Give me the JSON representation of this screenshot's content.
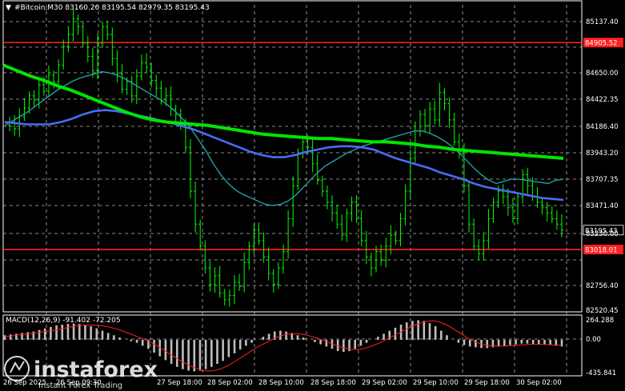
{
  "header": {
    "symbol_line": "#Bitcoin,M30  83160.26 83195.54 82979.35 83195.43",
    "macd_line": "MACD(12,26,9) -91.402 -72.205"
  },
  "watermark": {
    "brand": "instaforex",
    "tagline": "Instant Forex Trading"
  },
  "price_axis": {
    "labels": [
      "85137.40",
      "84905.52",
      "84650.00",
      "84422.35",
      "84186.40",
      "83943.20",
      "83707.35",
      "83471.40",
      "83230.00",
      "83195.43",
      "83018.01",
      "82756.40",
      "82520.45"
    ]
  },
  "macd_axis": {
    "labels": [
      "264.288",
      "0.00",
      "-435.841"
    ]
  },
  "time_axis": {
    "labels": [
      "26 Sep 2025",
      "26 Sep 09:30",
      "27 Sep 18:00",
      "28 Sep 02:00",
      "28 Sep 10:00",
      "28 Sep 18:00",
      "29 Sep 02:00",
      "29 Sep 10:00",
      "29 Sep 18:00",
      "30 Sep 02:00"
    ]
  },
  "chart_data": {
    "type": "line",
    "symbol": "#Bitcoin",
    "timeframe": "M30",
    "ohlc_last": {
      "open": 83160.26,
      "high": 83195.54,
      "low": 82979.35,
      "close": 83195.43
    },
    "ylim": [
      82450,
      85250
    ],
    "levels": [
      {
        "value": 84905.52,
        "label": "84905.52",
        "color": "#ff2020"
      },
      {
        "value": 83018.01,
        "label": "83018.01",
        "color": "#ff2020"
      }
    ],
    "current_price": {
      "value": 83195.43,
      "label": "83195.43"
    },
    "close_series": [
      84150,
      84180,
      84120,
      84230,
      84310,
      84420,
      84380,
      84520,
      84460,
      84610,
      84550,
      84700,
      84870,
      84980,
      85120,
      85050,
      84900,
      84780,
      84650,
      84900,
      85050,
      84980,
      84760,
      84620,
      84480,
      84550,
      84420,
      84600,
      84720,
      84680,
      84560,
      84490,
      84380,
      84420,
      84300,
      84250,
      84150,
      83950,
      83550,
      83250,
      83050,
      82850,
      82700,
      82780,
      82620,
      82560,
      82600,
      82720,
      82680,
      82900,
      83050,
      83200,
      83100,
      82950,
      82800,
      82700,
      82850,
      83000,
      83300,
      83600,
      83900,
      84000,
      83950,
      83800,
      83650,
      83550,
      83450,
      83350,
      83250,
      83150,
      83350,
      83450,
      83300,
      83100,
      82950,
      82850,
      83000,
      82920,
      83050,
      83150,
      83100,
      83300,
      83550,
      83850,
      84100,
      84250,
      84150,
      84300,
      84200,
      84450,
      84350,
      84200,
      84000,
      83900,
      83600,
      83250,
      83050,
      82980,
      83100,
      83300,
      83450,
      83550,
      83500,
      83400,
      83300,
      83500,
      83700,
      83600,
      83500,
      83450,
      83400,
      83350,
      83300,
      83250,
      83195
    ],
    "ma_fast": [
      84150,
      84190,
      84230,
      84270,
      84320,
      84370,
      84420,
      84470,
      84510,
      84550,
      84580,
      84600,
      84620,
      84640,
      84630,
      84610,
      84580,
      84540,
      84500,
      84460,
      84420,
      84380,
      84330,
      84270,
      84200,
      84120,
      84020,
      83920,
      83800,
      83700,
      83620,
      83560,
      83520,
      83490,
      83460,
      83430,
      83420,
      83430,
      83460,
      83510,
      83580,
      83650,
      83720,
      83780,
      83820,
      83860,
      83900,
      83930,
      83960,
      83980,
      84000,
      84020,
      84040,
      84060,
      84080,
      84100,
      84100,
      84080,
      84050,
      84010,
      83960,
      83900,
      83830,
      83760,
      83700,
      83650,
      83620,
      83640,
      83660,
      83660,
      83650,
      83640,
      83630,
      83620,
      83650,
      83660
    ],
    "ma_mid": [
      84180,
      84170,
      84160,
      84160,
      84160,
      84180,
      84210,
      84250,
      84280,
      84290,
      84280,
      84260,
      84240,
      84220,
      84190,
      84170,
      84140,
      84110,
      84070,
      84030,
      83990,
      83950,
      83910,
      83880,
      83860,
      83860,
      83880,
      83910,
      83930,
      83950,
      83960,
      83960,
      83950,
      83930,
      83890,
      83850,
      83820,
      83790,
      83760,
      83720,
      83690,
      83660,
      83620,
      83590,
      83570,
      83550,
      83530,
      83510,
      83490,
      83480,
      83470
    ],
    "ma_slow": [
      84700,
      84650,
      84600,
      84560,
      84510,
      84470,
      84420,
      84370,
      84320,
      84270,
      84230,
      84200,
      84180,
      84170,
      84160,
      84150,
      84130,
      84110,
      84090,
      84070,
      84060,
      84050,
      84040,
      84030,
      84030,
      84020,
      84010,
      84000,
      84000,
      83990,
      83980,
      83960,
      83950,
      83930,
      83920,
      83910,
      83900,
      83890,
      83880,
      83870,
      83860,
      83850
    ],
    "macd": {
      "ylim": [
        -435.841,
        264.288
      ],
      "histogram": [
        60,
        70,
        80,
        90,
        100,
        110,
        130,
        150,
        170,
        190,
        200,
        210,
        215,
        210,
        200,
        180,
        150,
        120,
        90,
        60,
        30,
        0,
        -20,
        -40,
        -80,
        -120,
        -170,
        -220,
        -270,
        -320,
        -360,
        -390,
        -410,
        -420,
        -410,
        -390,
        -360,
        -320,
        -280,
        -230,
        -180,
        -130,
        -80,
        -40,
        0,
        40,
        80,
        110,
        120,
        110,
        90,
        60,
        30,
        0,
        -30,
        -60,
        -90,
        -120,
        -150,
        -160,
        -150,
        -120,
        -80,
        -40,
        0,
        40,
        80,
        120,
        160,
        200,
        230,
        250,
        260,
        250,
        220,
        180,
        120,
        60,
        0,
        -40,
        -70,
        -90,
        -100,
        -110,
        -110,
        -100,
        -90,
        -80,
        -70,
        -60,
        -50,
        -50,
        -55,
        -60,
        -65,
        -70,
        -80,
        -90
      ],
      "signal": [
        40,
        50,
        60,
        70,
        80,
        90,
        100,
        110,
        120,
        135,
        150,
        165,
        180,
        190,
        195,
        195,
        190,
        180,
        165,
        145,
        120,
        90,
        60,
        30,
        0,
        -40,
        -80,
        -130,
        -180,
        -230,
        -280,
        -320,
        -360,
        -390,
        -410,
        -415,
        -405,
        -380,
        -345,
        -300,
        -250,
        -200,
        -150,
        -100,
        -60,
        -20,
        20,
        50,
        70,
        80,
        80,
        70,
        50,
        30,
        0,
        -30,
        -60,
        -90,
        -110,
        -125,
        -130,
        -120,
        -100,
        -70,
        -40,
        0,
        40,
        80,
        120,
        160,
        195,
        225,
        245,
        250,
        240,
        210,
        170,
        120,
        70,
        20,
        -20,
        -50,
        -70,
        -80,
        -85,
        -85,
        -80,
        -75,
        -70,
        -65,
        -60,
        -60,
        -62,
        -66,
        -70,
        -75
      ]
    }
  }
}
